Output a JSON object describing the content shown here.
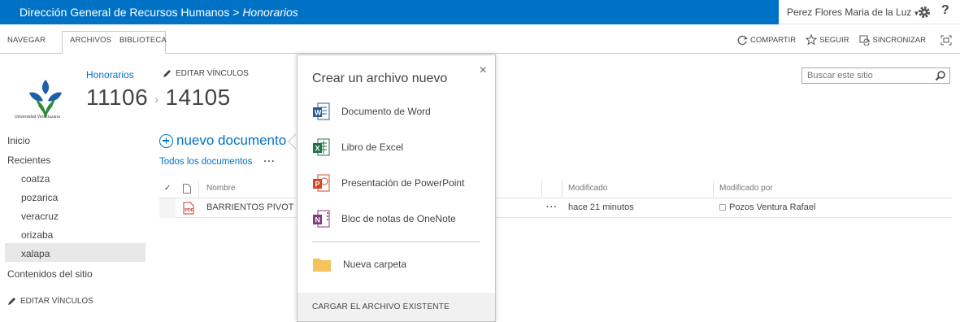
{
  "suite_bar": {
    "site_path": "Dirección General de Recursos Humanos",
    "separator": " > ",
    "current_site": "Honorarios",
    "user_name": "Perez Flores Maria de la Luz",
    "help_glyph": "?"
  },
  "ribbon": {
    "tabs": [
      "NAVEGAR",
      "ARCHIVOS",
      "BIBLIOTECA"
    ],
    "actions": {
      "share": "COMPARTIR",
      "follow": "SEGUIR",
      "sync": "SINCRONIZAR"
    }
  },
  "header": {
    "logo_caption": "Universidad Veracruzana",
    "breadcrumb_link": "Honorarios",
    "edit_links": "EDITAR VÍNCULOS",
    "title_part1": "11106",
    "title_sep": "›",
    "title_part2": "14105",
    "search_placeholder": "Buscar este sitio"
  },
  "left_nav": {
    "items": [
      {
        "label": "Inicio"
      },
      {
        "label": "Recientes"
      }
    ],
    "sub_items": [
      {
        "label": "coatza"
      },
      {
        "label": "pozarica"
      },
      {
        "label": "veracruz"
      },
      {
        "label": "orizaba"
      },
      {
        "label": "xalapa"
      }
    ],
    "site_contents": "Contenidos del sitio",
    "edit_links": "EDITAR VÍNCULOS"
  },
  "library": {
    "new_document": "nuevo documento",
    "view_all": "Todos los documentos",
    "view_more": "···",
    "columns": {
      "check": "✓",
      "name": "Nombre",
      "modified": "Modificado",
      "modified_by": "Modificado por"
    },
    "rows": [
      {
        "name": "BARRIENTOS PIVOT FL",
        "dots": "···",
        "modified": "hace 21 minutos",
        "modified_by": "Pozos Ventura Rafael"
      }
    ]
  },
  "callout": {
    "title": "Crear un archivo nuevo",
    "close": "×",
    "options": [
      {
        "label": "Documento de Word",
        "icon": "word-icon",
        "color": "#2b579a",
        "letter": "W"
      },
      {
        "label": "Libro de Excel",
        "icon": "excel-icon",
        "color": "#217346",
        "letter": "X"
      },
      {
        "label": "Presentación de PowerPoint",
        "icon": "powerpoint-icon",
        "color": "#d24726",
        "letter": "P"
      },
      {
        "label": "Bloc de notas de OneNote",
        "icon": "onenote-icon",
        "color": "#80397b",
        "letter": "N"
      }
    ],
    "folder": "Nueva carpeta",
    "upload": "CARGAR EL ARCHIVO EXISTENTE"
  },
  "colors": {
    "brand": "#0072c6",
    "folder": "#f6c25b"
  }
}
